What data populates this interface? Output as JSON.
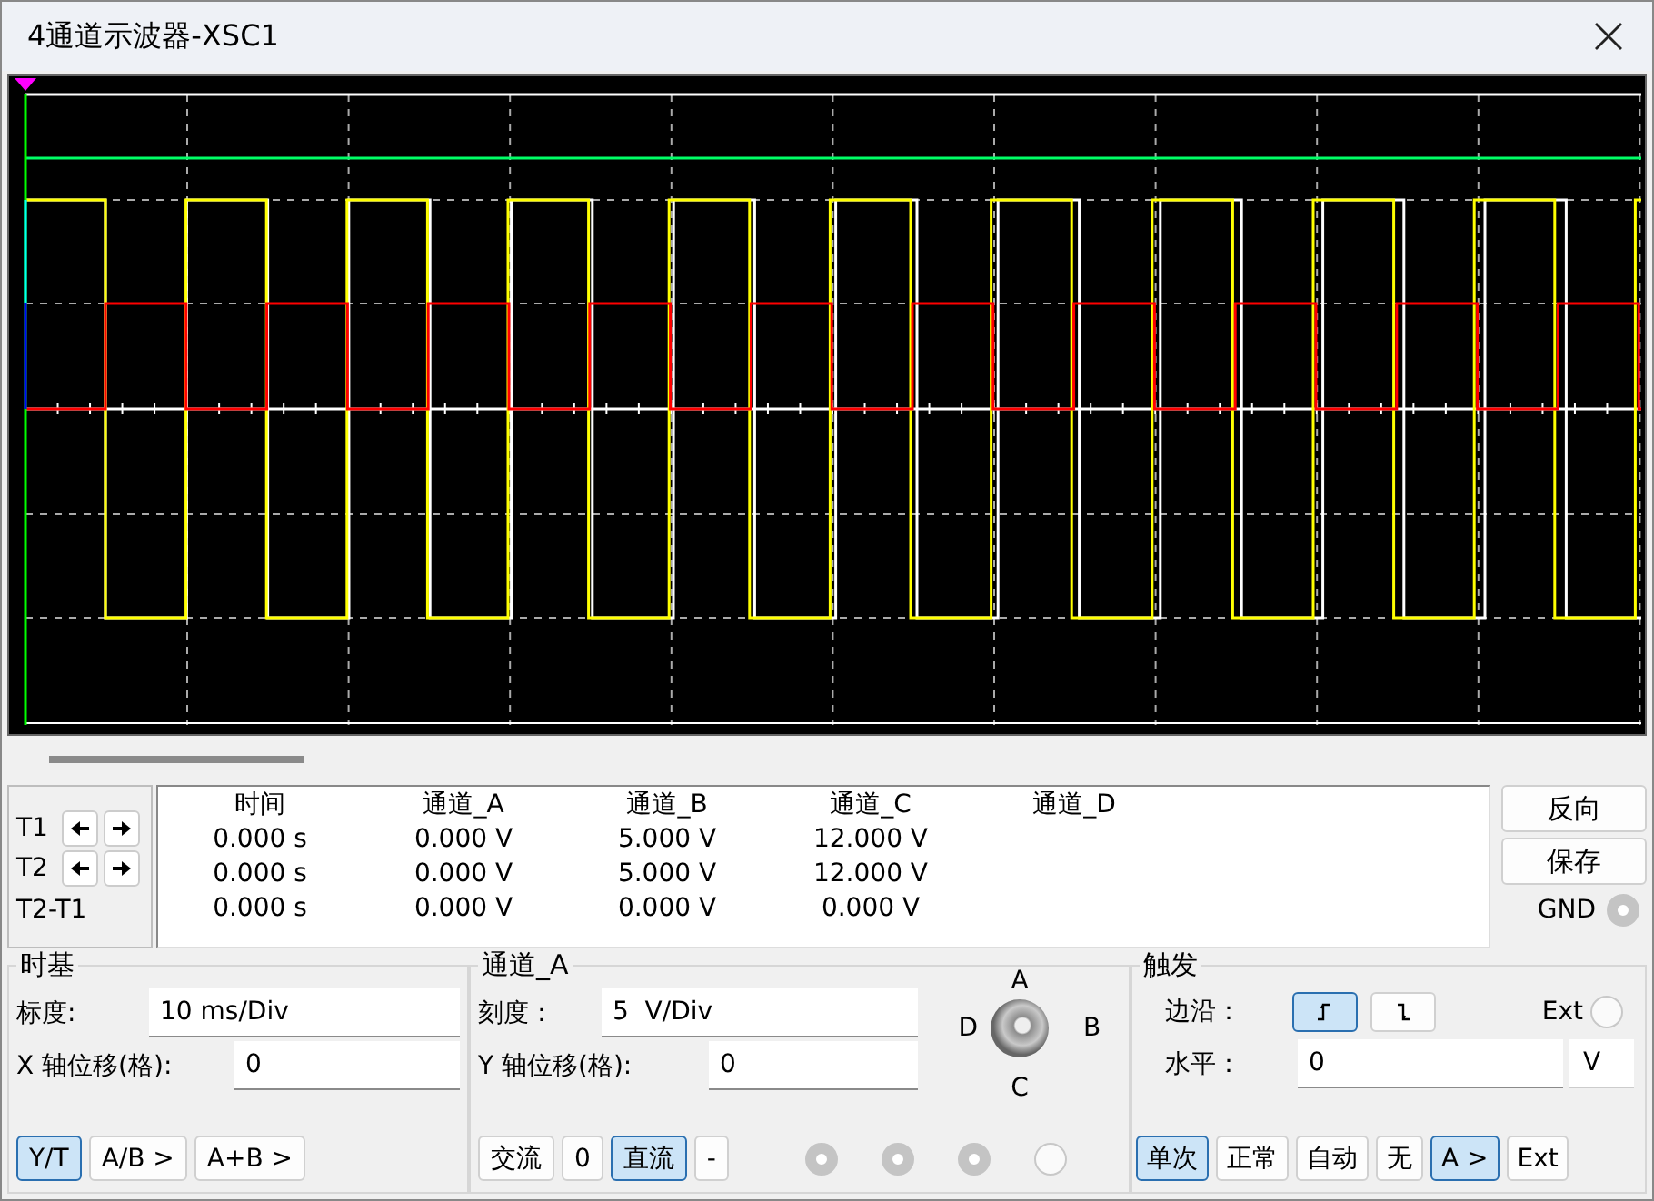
{
  "window": {
    "title": "4通道示波器-XSC1"
  },
  "cursors": [
    {
      "label": "T1"
    },
    {
      "label": "T2"
    }
  ],
  "cursor_diff_label": "T2-T1",
  "readout": {
    "columns": [
      "时间",
      "通道_A",
      "通道_B",
      "通道_C",
      "通道_D"
    ],
    "rows": [
      [
        "0.000 s",
        "0.000 V",
        "5.000 V",
        "12.000 V"
      ],
      [
        "0.000 s",
        "0.000 V",
        "5.000 V",
        "12.000 V"
      ],
      [
        "0.000 s",
        "0.000 V",
        "0.000 V",
        "0.000 V"
      ]
    ]
  },
  "side_buttons": [
    "反向",
    "保存"
  ],
  "gnd": {
    "label": "GND",
    "connected": true
  },
  "timebase": {
    "title": "时基",
    "scale": {
      "label": "标度:",
      "value": "10 ms/Div"
    },
    "x_offset": {
      "label": "X 轴位移(格):",
      "value": "0"
    },
    "modes": [
      {
        "label": "Y/T",
        "selected": true
      },
      {
        "label": "A/B >",
        "selected": false
      },
      {
        "label": "A+B >",
        "selected": false
      }
    ]
  },
  "channel": {
    "title": "通道_A",
    "scale": {
      "label": "刻度：",
      "value": "5  V/Div"
    },
    "y_offset": {
      "label": "Y 轴位移(格):",
      "value": "0"
    },
    "selector": {
      "top": "A",
      "left": "D",
      "right": "B",
      "bottom": "C"
    },
    "coupling": [
      {
        "label": "交流",
        "selected": false
      },
      {
        "label": "0",
        "selected": false
      },
      {
        "label": "直流",
        "selected": true
      },
      {
        "label": "-",
        "selected": false
      }
    ],
    "terminals": [
      {
        "connected": true
      },
      {
        "connected": true
      },
      {
        "connected": true
      },
      {
        "connected": false
      }
    ]
  },
  "trigger": {
    "title": "触发",
    "edge_label": "边沿：",
    "edges": [
      {
        "kind": "rising",
        "selected": true
      },
      {
        "kind": "falling",
        "selected": false
      }
    ],
    "ext": {
      "label": "Ext",
      "connected": false
    },
    "level": {
      "label": "水平：",
      "value": "0",
      "unit": "V"
    },
    "modes": [
      {
        "label": "单次",
        "selected": true
      },
      {
        "label": "正常",
        "selected": false
      },
      {
        "label": "自动",
        "selected": false
      },
      {
        "label": "无",
        "selected": false
      }
    ],
    "sources": [
      {
        "label": "A >",
        "selected": true
      },
      {
        "label": "Ext",
        "selected": false
      }
    ]
  }
}
